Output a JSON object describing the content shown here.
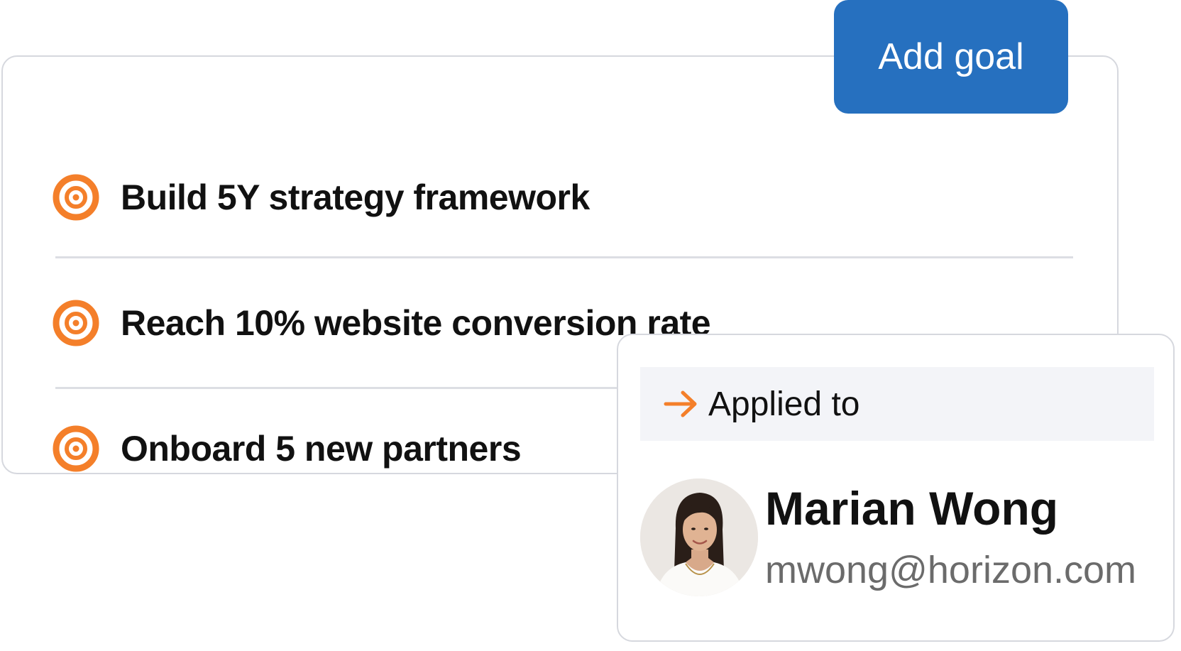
{
  "goals": [
    {
      "label": "Build 5Y strategy framework",
      "icon": "target-icon"
    },
    {
      "label": "Reach 10% website conversion rate",
      "icon": "target-icon"
    },
    {
      "label": "Onboard 5 new partners",
      "icon": "target-icon"
    }
  ],
  "add_goal_button": {
    "label": "Add goal"
  },
  "applied_to": {
    "header_label": "Applied to",
    "header_icon": "arrow-right-icon",
    "user": {
      "name": "Marian Wong",
      "email": "mwong@horizon.com",
      "avatar": "avatar-photo"
    }
  },
  "colors": {
    "accent_orange": "#f47f2a",
    "button_blue": "#2670bf",
    "border_gray": "#d6d8de",
    "header_bg": "#f3f4f8",
    "email_gray": "#6b6b6b"
  }
}
